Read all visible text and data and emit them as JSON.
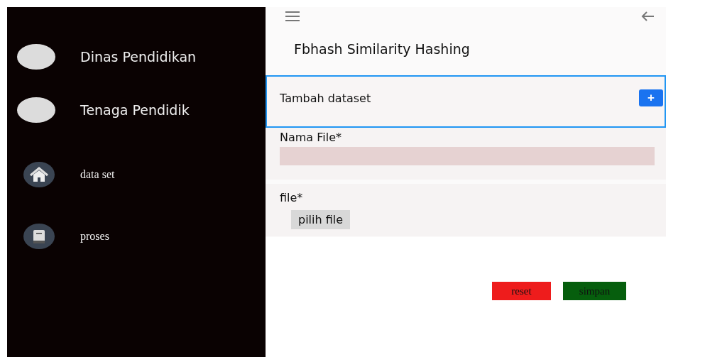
{
  "sidebar": {
    "items": [
      {
        "kind": "avatar",
        "label": "Dinas Pendidikan"
      },
      {
        "kind": "avatar",
        "label": "Tenaga Pendidik"
      },
      {
        "kind": "home",
        "label": "data set"
      },
      {
        "kind": "book",
        "label": "proses"
      }
    ]
  },
  "header": {
    "title": "Fbhash Similarity Hashing"
  },
  "card": {
    "title": "Tambah dataset",
    "add_button": "+"
  },
  "form": {
    "fields": [
      {
        "kind": "text",
        "label": "Nama File*"
      },
      {
        "kind": "file",
        "label": "file*",
        "button": "pilih file"
      }
    ]
  },
  "buttons": [
    {
      "kind": "reset",
      "label": "reset"
    },
    {
      "kind": "save",
      "label": "simpan"
    }
  ]
}
